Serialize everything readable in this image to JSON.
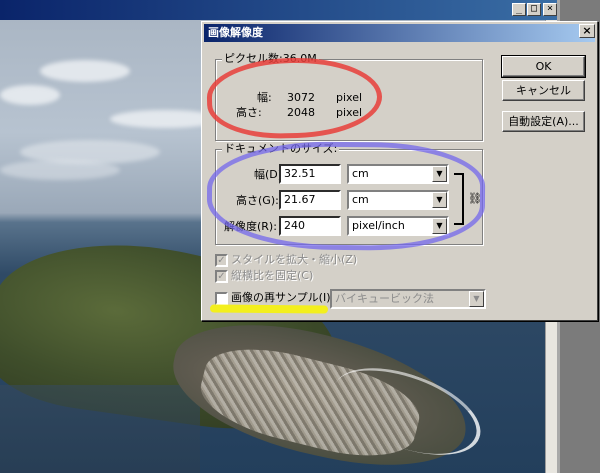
{
  "dialog": {
    "title": "画像解像度",
    "close_glyph": "×",
    "buttons": {
      "ok": "OK",
      "cancel": "キャンセル",
      "auto": "自動設定(A)..."
    },
    "pixel_dimensions": {
      "legend": "ピクセル数:36.0M",
      "width_label": "幅:",
      "width_value": "3072",
      "width_unit": "pixel",
      "height_label": "高さ:",
      "height_value": "2048",
      "height_unit": "pixel"
    },
    "document_size": {
      "legend": "ドキュメントのサイズ:",
      "width_label": "幅(D):",
      "width_value": "32.51",
      "width_unit": "cm",
      "height_label": "高さ(G):",
      "height_value": "21.67",
      "height_unit": "cm",
      "resolution_label": "解像度(R):",
      "resolution_value": "240",
      "resolution_unit": "pixel/inch"
    },
    "options": {
      "scale_styles": "スタイルを拡大・縮小(Z)",
      "constrain_proportions": "縦横比を固定(C)",
      "resample": "画像の再サンプル(I):",
      "resample_method": "バイキュービック法",
      "check_glyph": "✓"
    }
  },
  "window_buttons": {
    "minimize": "_",
    "maximize": "□",
    "close": "×"
  },
  "annotation_colors": {
    "red": "#e83e3a",
    "blue": "#7468ec",
    "yellow": "#f4f014"
  }
}
